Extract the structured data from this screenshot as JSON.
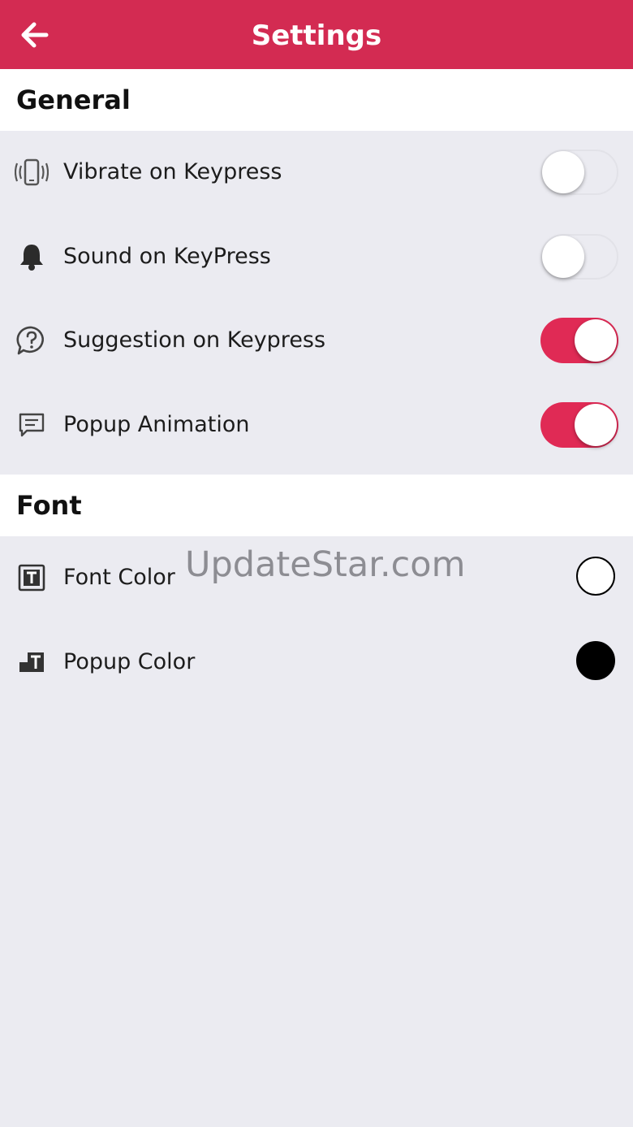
{
  "header": {
    "title": "Settings",
    "back_icon": "arrow-left-icon",
    "color": "#d32b52"
  },
  "sections": {
    "general": {
      "title": "General",
      "items": [
        {
          "label": "Vibrate on Keypress",
          "icon": "vibrate-icon",
          "enabled": false
        },
        {
          "label": "Sound on KeyPress",
          "icon": "bell-icon",
          "enabled": false
        },
        {
          "label": "Suggestion on Keypress",
          "icon": "question-bubble-icon",
          "enabled": true
        },
        {
          "label": "Popup Animation",
          "icon": "message-icon",
          "enabled": true
        }
      ]
    },
    "font": {
      "title": "Font",
      "items": [
        {
          "label": "Font Color",
          "icon": "text-box-icon",
          "color": "#ffffff"
        },
        {
          "label": "Popup Color",
          "icon": "text-popup-icon",
          "color": "#000000"
        }
      ]
    }
  },
  "watermark": "UpdateStar.com",
  "colors": {
    "accent": "#e02a55",
    "background": "#ebebf1"
  }
}
